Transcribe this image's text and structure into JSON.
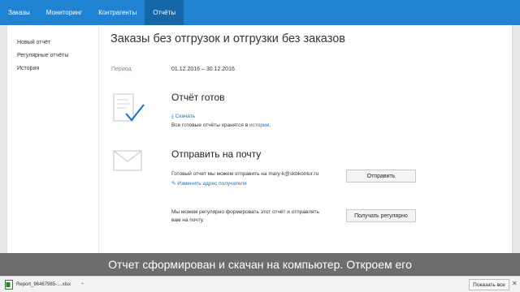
{
  "topnav": {
    "tabs": [
      {
        "label": "Заказы"
      },
      {
        "label": "Мониторинг"
      },
      {
        "label": "Контрагенты"
      },
      {
        "label": "Отчёты"
      }
    ]
  },
  "sidebar": {
    "items": [
      {
        "label": "Новый отчёт"
      },
      {
        "label": "Регулярные отчёты"
      },
      {
        "label": "История"
      }
    ]
  },
  "main": {
    "title": "Заказы без отгрузок и отгрузки без заказов",
    "period_label": "Период",
    "period_value": "01.12.2016 – 30.12.2016",
    "ready": {
      "title": "Отчёт готов",
      "download_link": "Скачать",
      "history_text": "Все готовые отчёты хранятся в ",
      "history_link": "истории",
      "history_suffix": "."
    },
    "email": {
      "title": "Отправить на почту",
      "send_text": "Готовый отчет мы можем отправить на mary-k@skbkontur.ru",
      "change_link": "Изменить адрес получателя",
      "send_button": "Отправить",
      "regular_text_1": "Мы можем регулярно формировать этот отчёт и отправлять",
      "regular_text_2": "вам на почту.",
      "regular_button": "Получать регулярно"
    }
  },
  "caption": "Отчет сформирован и скачан на компьютер. Откроем его",
  "downloads": {
    "file_name": "Report_96467985-....xlsx",
    "show_all": "Показать все"
  },
  "colors": {
    "accent": "#1f82d2",
    "accent_active": "#1567a8",
    "link": "#1f6fc1"
  }
}
